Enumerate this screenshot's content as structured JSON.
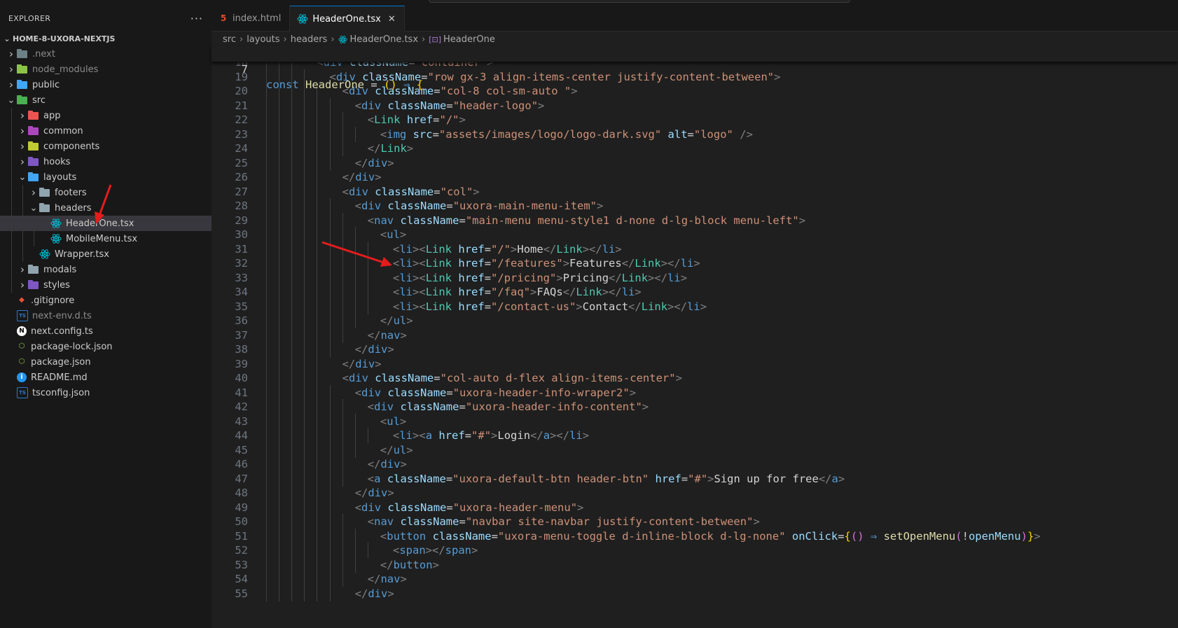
{
  "sidebar": {
    "title": "EXPLORER",
    "more": "···",
    "project": "HOME-8-UXORA-NEXTJS",
    "items": [
      {
        "label": ".next",
        "kind": "folder",
        "depth": 0,
        "expanded": false,
        "color": "#6d8086",
        "dim": true
      },
      {
        "label": "node_modules",
        "kind": "folder",
        "depth": 0,
        "expanded": false,
        "color": "#8bc34a",
        "dim": true
      },
      {
        "label": "public",
        "kind": "folder",
        "depth": 0,
        "expanded": false,
        "color": "#42a5f5"
      },
      {
        "label": "src",
        "kind": "folder",
        "depth": 0,
        "expanded": true,
        "color": "#4caf50"
      },
      {
        "label": "app",
        "kind": "folder",
        "depth": 1,
        "expanded": false,
        "color": "#ef5350"
      },
      {
        "label": "common",
        "kind": "folder",
        "depth": 1,
        "expanded": false,
        "color": "#ab47bc"
      },
      {
        "label": "components",
        "kind": "folder",
        "depth": 1,
        "expanded": false,
        "color": "#c0ca33"
      },
      {
        "label": "hooks",
        "kind": "folder",
        "depth": 1,
        "expanded": false,
        "color": "#7e57c2"
      },
      {
        "label": "layouts",
        "kind": "folder",
        "depth": 1,
        "expanded": true,
        "color": "#42a5f5"
      },
      {
        "label": "footers",
        "kind": "folder",
        "depth": 2,
        "expanded": false,
        "color": "#90a4ae"
      },
      {
        "label": "headers",
        "kind": "folder",
        "depth": 2,
        "expanded": true,
        "color": "#90a4ae"
      },
      {
        "label": "HeaderOne.tsx",
        "kind": "react",
        "depth": 3,
        "selected": true
      },
      {
        "label": "MobileMenu.tsx",
        "kind": "react",
        "depth": 3
      },
      {
        "label": "Wrapper.tsx",
        "kind": "react",
        "depth": 2
      },
      {
        "label": "modals",
        "kind": "folder",
        "depth": 1,
        "expanded": false,
        "color": "#90a4ae"
      },
      {
        "label": "styles",
        "kind": "folder",
        "depth": 1,
        "expanded": false,
        "color": "#7e57c2"
      },
      {
        "label": ".gitignore",
        "kind": "git",
        "depth": 0
      },
      {
        "label": "next-env.d.ts",
        "kind": "ts",
        "depth": 0,
        "dim": true
      },
      {
        "label": "next.config.ts",
        "kind": "next",
        "depth": 0
      },
      {
        "label": "package-lock.json",
        "kind": "npm",
        "depth": 0
      },
      {
        "label": "package.json",
        "kind": "npm",
        "depth": 0
      },
      {
        "label": "README.md",
        "kind": "info",
        "depth": 0
      },
      {
        "label": "tsconfig.json",
        "kind": "ts",
        "depth": 0
      }
    ]
  },
  "tabs": [
    {
      "label": "index.html",
      "icon": "html-icon",
      "active": false
    },
    {
      "label": "HeaderOne.tsx",
      "icon": "react-icon",
      "active": true,
      "close": "✕"
    }
  ],
  "breadcrumb": [
    "src",
    "layouts",
    "headers",
    "HeaderOne.tsx",
    "HeaderOne"
  ],
  "sticky": {
    "num": "7",
    "html": "<span class=\"k\">const</span> <span class=\"f\">HeaderOne</span> <span class=\"p\">=</span> <span class=\"b\">()</span> <span class=\"k\">⇒</span> <span class=\"b\">{</span>"
  },
  "code_lines": [
    {
      "num": "18",
      "indent": 4,
      "html": "<span class=\"tb\">&lt;</span><span class=\"tg\">div</span> <span class=\"at\">className</span><span class=\"tx\">=</span><span class=\"st\">\"container\"</span><span class=\"tb\">&gt;</span>"
    },
    {
      "num": "19",
      "indent": 5,
      "html": "<span class=\"tb\">&lt;</span><span class=\"tg\">div</span> <span class=\"at\">className</span><span class=\"tx\">=</span><span class=\"st\">\"row gx-3 align-items-center justify-content-between\"</span><span class=\"tb\">&gt;</span>"
    },
    {
      "num": "20",
      "indent": 6,
      "html": "<span class=\"tb\">&lt;</span><span class=\"tg\">div</span> <span class=\"at\">className</span><span class=\"tx\">=</span><span class=\"st\">\"col-8 col-sm-auto \"</span><span class=\"tb\">&gt;</span>"
    },
    {
      "num": "21",
      "indent": 7,
      "html": "<span class=\"tb\">&lt;</span><span class=\"tg\">div</span> <span class=\"at\">className</span><span class=\"tx\">=</span><span class=\"st\">\"header-logo\"</span><span class=\"tb\">&gt;</span>"
    },
    {
      "num": "22",
      "indent": 8,
      "html": "<span class=\"tb\">&lt;</span><span class=\"cp\">Link</span> <span class=\"at\">href</span><span class=\"tx\">=</span><span class=\"st\">\"/\"</span><span class=\"tb\">&gt;</span>"
    },
    {
      "num": "23",
      "indent": 9,
      "html": "<span class=\"tb\">&lt;</span><span class=\"tg\">img</span> <span class=\"at\">src</span><span class=\"tx\">=</span><span class=\"st\">\"assets/images/logo/logo-dark.svg\"</span> <span class=\"at\">alt</span><span class=\"tx\">=</span><span class=\"st\">\"logo\"</span> <span class=\"tb\">/&gt;</span>"
    },
    {
      "num": "24",
      "indent": 8,
      "html": "<span class=\"tb\">&lt;/</span><span class=\"cp\">Link</span><span class=\"tb\">&gt;</span>"
    },
    {
      "num": "25",
      "indent": 7,
      "html": "<span class=\"tb\">&lt;/</span><span class=\"tg\">div</span><span class=\"tb\">&gt;</span>"
    },
    {
      "num": "26",
      "indent": 6,
      "html": "<span class=\"tb\">&lt;/</span><span class=\"tg\">div</span><span class=\"tb\">&gt;</span>"
    },
    {
      "num": "27",
      "indent": 6,
      "html": "<span class=\"tb\">&lt;</span><span class=\"tg\">div</span> <span class=\"at\">className</span><span class=\"tx\">=</span><span class=\"st\">\"col\"</span><span class=\"tb\">&gt;</span>"
    },
    {
      "num": "28",
      "indent": 7,
      "html": "<span class=\"tb\">&lt;</span><span class=\"tg\">div</span> <span class=\"at\">className</span><span class=\"tx\">=</span><span class=\"st\">\"uxora-main-menu-item\"</span><span class=\"tb\">&gt;</span>"
    },
    {
      "num": "29",
      "indent": 8,
      "html": "<span class=\"tb\">&lt;</span><span class=\"tg\">nav</span> <span class=\"at\">className</span><span class=\"tx\">=</span><span class=\"st\">\"main-menu menu-style1 d-none d-lg-block menu-left\"</span><span class=\"tb\">&gt;</span>"
    },
    {
      "num": "30",
      "indent": 9,
      "html": "<span class=\"tb\">&lt;</span><span class=\"tg\">ul</span><span class=\"tb\">&gt;</span>"
    },
    {
      "num": "31",
      "indent": 10,
      "html": "<span class=\"tb\">&lt;</span><span class=\"tg\">li</span><span class=\"tb\">&gt;&lt;</span><span class=\"cp\">Link</span> <span class=\"at\">href</span><span class=\"tx\">=</span><span class=\"st\">\"/\"</span><span class=\"tb\">&gt;</span><span class=\"tx\">Home</span><span class=\"tb\">&lt;/</span><span class=\"cp\">Link</span><span class=\"tb\">&gt;&lt;/</span><span class=\"tg\">li</span><span class=\"tb\">&gt;</span>"
    },
    {
      "num": "32",
      "indent": 10,
      "html": "<span class=\"tb\">&lt;</span><span class=\"tg\">li</span><span class=\"tb\">&gt;&lt;</span><span class=\"cp\">Link</span> <span class=\"at\">href</span><span class=\"tx\">=</span><span class=\"st\">\"/features\"</span><span class=\"tb\">&gt;</span><span class=\"tx\">Features</span><span class=\"tb\">&lt;/</span><span class=\"cp\">Link</span><span class=\"tb\">&gt;&lt;/</span><span class=\"tg\">li</span><span class=\"tb\">&gt;</span>"
    },
    {
      "num": "33",
      "indent": 10,
      "html": "<span class=\"tb\">&lt;</span><span class=\"tg\">li</span><span class=\"tb\">&gt;&lt;</span><span class=\"cp\">Link</span> <span class=\"at\">href</span><span class=\"tx\">=</span><span class=\"st\">\"/pricing\"</span><span class=\"tb\">&gt;</span><span class=\"tx\">Pricing</span><span class=\"tb\">&lt;/</span><span class=\"cp\">Link</span><span class=\"tb\">&gt;&lt;/</span><span class=\"tg\">li</span><span class=\"tb\">&gt;</span>"
    },
    {
      "num": "34",
      "indent": 10,
      "html": "<span class=\"tb\">&lt;</span><span class=\"tg\">li</span><span class=\"tb\">&gt;&lt;</span><span class=\"cp\">Link</span> <span class=\"at\">href</span><span class=\"tx\">=</span><span class=\"st\">\"/faq\"</span><span class=\"tb\">&gt;</span><span class=\"tx\">FAQs</span><span class=\"tb\">&lt;/</span><span class=\"cp\">Link</span><span class=\"tb\">&gt;&lt;/</span><span class=\"tg\">li</span><span class=\"tb\">&gt;</span>"
    },
    {
      "num": "35",
      "indent": 10,
      "html": "<span class=\"tb\">&lt;</span><span class=\"tg\">li</span><span class=\"tb\">&gt;&lt;</span><span class=\"cp\">Link</span> <span class=\"at\">href</span><span class=\"tx\">=</span><span class=\"st\">\"/contact-us\"</span><span class=\"tb\">&gt;</span><span class=\"tx\">Contact</span><span class=\"tb\">&lt;/</span><span class=\"cp\">Link</span><span class=\"tb\">&gt;&lt;/</span><span class=\"tg\">li</span><span class=\"tb\">&gt;</span>"
    },
    {
      "num": "36",
      "indent": 9,
      "html": "<span class=\"tb\">&lt;/</span><span class=\"tg\">ul</span><span class=\"tb\">&gt;</span>"
    },
    {
      "num": "37",
      "indent": 8,
      "html": "<span class=\"tb\">&lt;/</span><span class=\"tg\">nav</span><span class=\"tb\">&gt;</span>"
    },
    {
      "num": "38",
      "indent": 7,
      "html": "<span class=\"tb\">&lt;/</span><span class=\"tg\">div</span><span class=\"tb\">&gt;</span>"
    },
    {
      "num": "39",
      "indent": 6,
      "html": "<span class=\"tb\">&lt;/</span><span class=\"tg\">div</span><span class=\"tb\">&gt;</span>"
    },
    {
      "num": "40",
      "indent": 6,
      "html": "<span class=\"tb\">&lt;</span><span class=\"tg\">div</span> <span class=\"at\">className</span><span class=\"tx\">=</span><span class=\"st\">\"col-auto d-flex align-items-center\"</span><span class=\"tb\">&gt;</span>"
    },
    {
      "num": "41",
      "indent": 7,
      "html": "<span class=\"tb\">&lt;</span><span class=\"tg\">div</span> <span class=\"at\">className</span><span class=\"tx\">=</span><span class=\"st\">\"uxora-header-info-wraper2\"</span><span class=\"tb\">&gt;</span>"
    },
    {
      "num": "42",
      "indent": 8,
      "html": "<span class=\"tb\">&lt;</span><span class=\"tg\">div</span> <span class=\"at\">className</span><span class=\"tx\">=</span><span class=\"st\">\"uxora-header-info-content\"</span><span class=\"tb\">&gt;</span>"
    },
    {
      "num": "43",
      "indent": 9,
      "html": "<span class=\"tb\">&lt;</span><span class=\"tg\">ul</span><span class=\"tb\">&gt;</span>"
    },
    {
      "num": "44",
      "indent": 10,
      "html": "<span class=\"tb\">&lt;</span><span class=\"tg\">li</span><span class=\"tb\">&gt;&lt;</span><span class=\"tg\">a</span> <span class=\"at\">href</span><span class=\"tx\">=</span><span class=\"st\">\"#\"</span><span class=\"tb\">&gt;</span><span class=\"tx\">Login</span><span class=\"tb\">&lt;/</span><span class=\"tg\">a</span><span class=\"tb\">&gt;&lt;/</span><span class=\"tg\">li</span><span class=\"tb\">&gt;</span>"
    },
    {
      "num": "45",
      "indent": 9,
      "html": "<span class=\"tb\">&lt;/</span><span class=\"tg\">ul</span><span class=\"tb\">&gt;</span>"
    },
    {
      "num": "46",
      "indent": 8,
      "html": "<span class=\"tb\">&lt;/</span><span class=\"tg\">div</span><span class=\"tb\">&gt;</span>"
    },
    {
      "num": "47",
      "indent": 8,
      "html": "<span class=\"tb\">&lt;</span><span class=\"tg\">a</span> <span class=\"at\">className</span><span class=\"tx\">=</span><span class=\"st\">\"uxora-default-btn header-btn\"</span> <span class=\"at\">href</span><span class=\"tx\">=</span><span class=\"st\">\"#\"</span><span class=\"tb\">&gt;</span><span class=\"tx\">Sign up for free</span><span class=\"tb\">&lt;/</span><span class=\"tg\">a</span><span class=\"tb\">&gt;</span>"
    },
    {
      "num": "48",
      "indent": 7,
      "html": "<span class=\"tb\">&lt;/</span><span class=\"tg\">div</span><span class=\"tb\">&gt;</span>"
    },
    {
      "num": "49",
      "indent": 7,
      "html": "<span class=\"tb\">&lt;</span><span class=\"tg\">div</span> <span class=\"at\">className</span><span class=\"tx\">=</span><span class=\"st\">\"uxora-header-menu\"</span><span class=\"tb\">&gt;</span>"
    },
    {
      "num": "50",
      "indent": 8,
      "html": "<span class=\"tb\">&lt;</span><span class=\"tg\">nav</span> <span class=\"at\">className</span><span class=\"tx\">=</span><span class=\"st\">\"navbar site-navbar justify-content-between\"</span><span class=\"tb\">&gt;</span>"
    },
    {
      "num": "51",
      "indent": 9,
      "html": "<span class=\"tb\">&lt;</span><span class=\"tg\">button</span> <span class=\"at\">className</span><span class=\"tx\">=</span><span class=\"st\">\"uxora-menu-toggle d-inline-block d-lg-none\"</span> <span class=\"at\">onClick</span><span class=\"tx\">=</span><span class=\"b\">{</span><span class=\"pu\">()</span> <span class=\"k\">⇒</span> <span class=\"f\">setOpenMenu</span><span class=\"pu\">(</span><span class=\"tx\">!</span><span class=\"at\">openMenu</span><span class=\"pu\">)</span><span class=\"b\">}</span><span class=\"tb\">&gt;</span>"
    },
    {
      "num": "52",
      "indent": 10,
      "html": "<span class=\"tb\">&lt;</span><span class=\"tg\">span</span><span class=\"tb\">&gt;&lt;/</span><span class=\"tg\">span</span><span class=\"tb\">&gt;</span>"
    },
    {
      "num": "53",
      "indent": 9,
      "html": "<span class=\"tb\">&lt;/</span><span class=\"tg\">button</span><span class=\"tb\">&gt;</span>"
    },
    {
      "num": "54",
      "indent": 8,
      "html": "<span class=\"tb\">&lt;/</span><span class=\"tg\">nav</span><span class=\"tb\">&gt;</span>"
    },
    {
      "num": "55",
      "indent": 7,
      "html": "<span class=\"tb\">&lt;/</span><span class=\"tg\">div</span><span class=\"tb\">&gt;</span>"
    }
  ],
  "colors": {
    "accent": "#0078d4",
    "arrow": "#e51c1c",
    "selection": "#37373d"
  }
}
